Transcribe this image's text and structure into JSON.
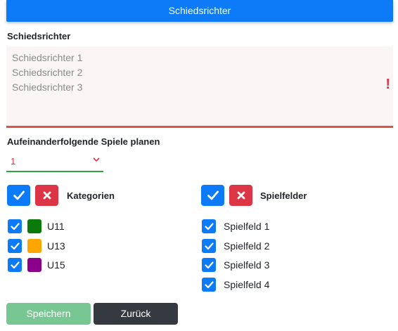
{
  "header": {
    "title": "Schiedsrichter"
  },
  "referees": {
    "label": "Schiedsrichter",
    "lines": [
      "Schiedsrichter 1",
      "Schiedsrichter 2",
      "Schiedsrichter 3"
    ],
    "error_mark": "!"
  },
  "consecutive": {
    "label": "Aufeinanderfolgende Spiele planen",
    "value": "1"
  },
  "categories": {
    "title": "Kategorien",
    "items": [
      {
        "label": "U11",
        "color": "#0b7a0b",
        "checked": true
      },
      {
        "label": "U13",
        "color": "#ffa500",
        "checked": true
      },
      {
        "label": "U15",
        "color": "#8b008b",
        "checked": true
      }
    ]
  },
  "fields": {
    "title": "Spielfelder",
    "items": [
      {
        "label": "Spielfeld 1",
        "checked": true
      },
      {
        "label": "Spielfeld 2",
        "checked": true
      },
      {
        "label": "Spielfeld 3",
        "checked": true
      },
      {
        "label": "Spielfeld 4",
        "checked": true
      }
    ]
  },
  "actions": {
    "save_label": "Speichern",
    "back_label": "Zurück"
  },
  "colors": {
    "primary": "#0d7bf7",
    "danger": "#dc3545",
    "success": "#28a745",
    "dark": "#343a40"
  }
}
